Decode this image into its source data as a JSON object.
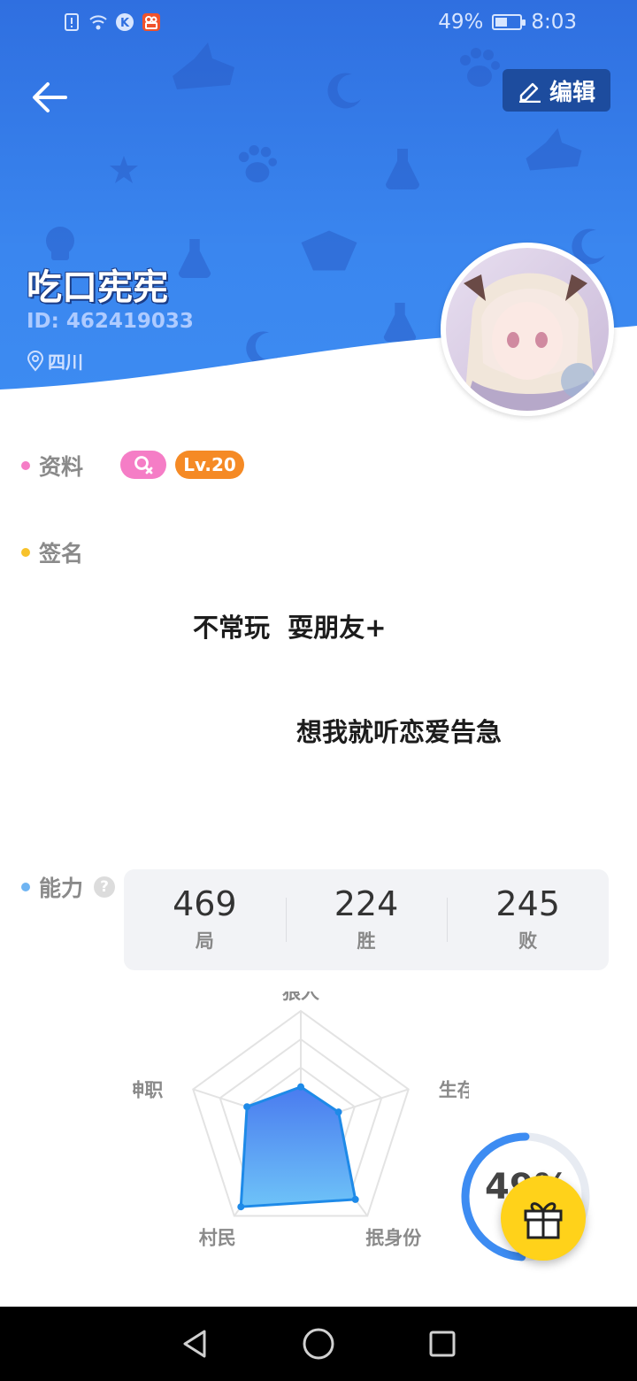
{
  "status_bar": {
    "battery": "49%",
    "battery_level": 0.49,
    "time": "8:03",
    "icons": [
      "sim-alert-icon",
      "wifi-icon",
      "k-app-icon",
      "kuaishou-icon"
    ]
  },
  "header": {
    "back_icon": "arrow-left-icon",
    "edit_label": "编辑",
    "edit_icon": "pencil-icon",
    "nickname": "吃口宪宪",
    "user_id": "ID: 462419033",
    "location": "四川",
    "location_icon": "map-pin-icon",
    "colors": {
      "bg": "#3a86ef",
      "edit_bg": "#1d4c9e"
    }
  },
  "profile": {
    "label": "资料",
    "gender_icon": "female-icon",
    "level": "Lv.20",
    "colors": {
      "gender": "#f57dc6",
      "level": "#f58a25"
    }
  },
  "signature": {
    "label": "签名",
    "lines": [
      "不常玩  耍朋友+",
      "想我就听恋爱告急"
    ]
  },
  "ability": {
    "label": "能力",
    "help_icon": "question-icon",
    "stats": [
      {
        "value": "469",
        "label": "局"
      },
      {
        "value": "224",
        "label": "胜"
      },
      {
        "value": "245",
        "label": "败"
      }
    ],
    "radar": {
      "axes": [
        "狼人",
        "生存",
        "抿身份",
        "村民",
        "神职"
      ],
      "values": [
        0.33,
        0.35,
        0.82,
        0.9,
        0.5
      ]
    },
    "win_rate": "49%",
    "win_rate_value": 0.49,
    "gift_icon": "gift-icon"
  },
  "nav": {
    "icons": [
      "back-triangle-icon",
      "home-circle-icon",
      "recents-square-icon"
    ]
  }
}
